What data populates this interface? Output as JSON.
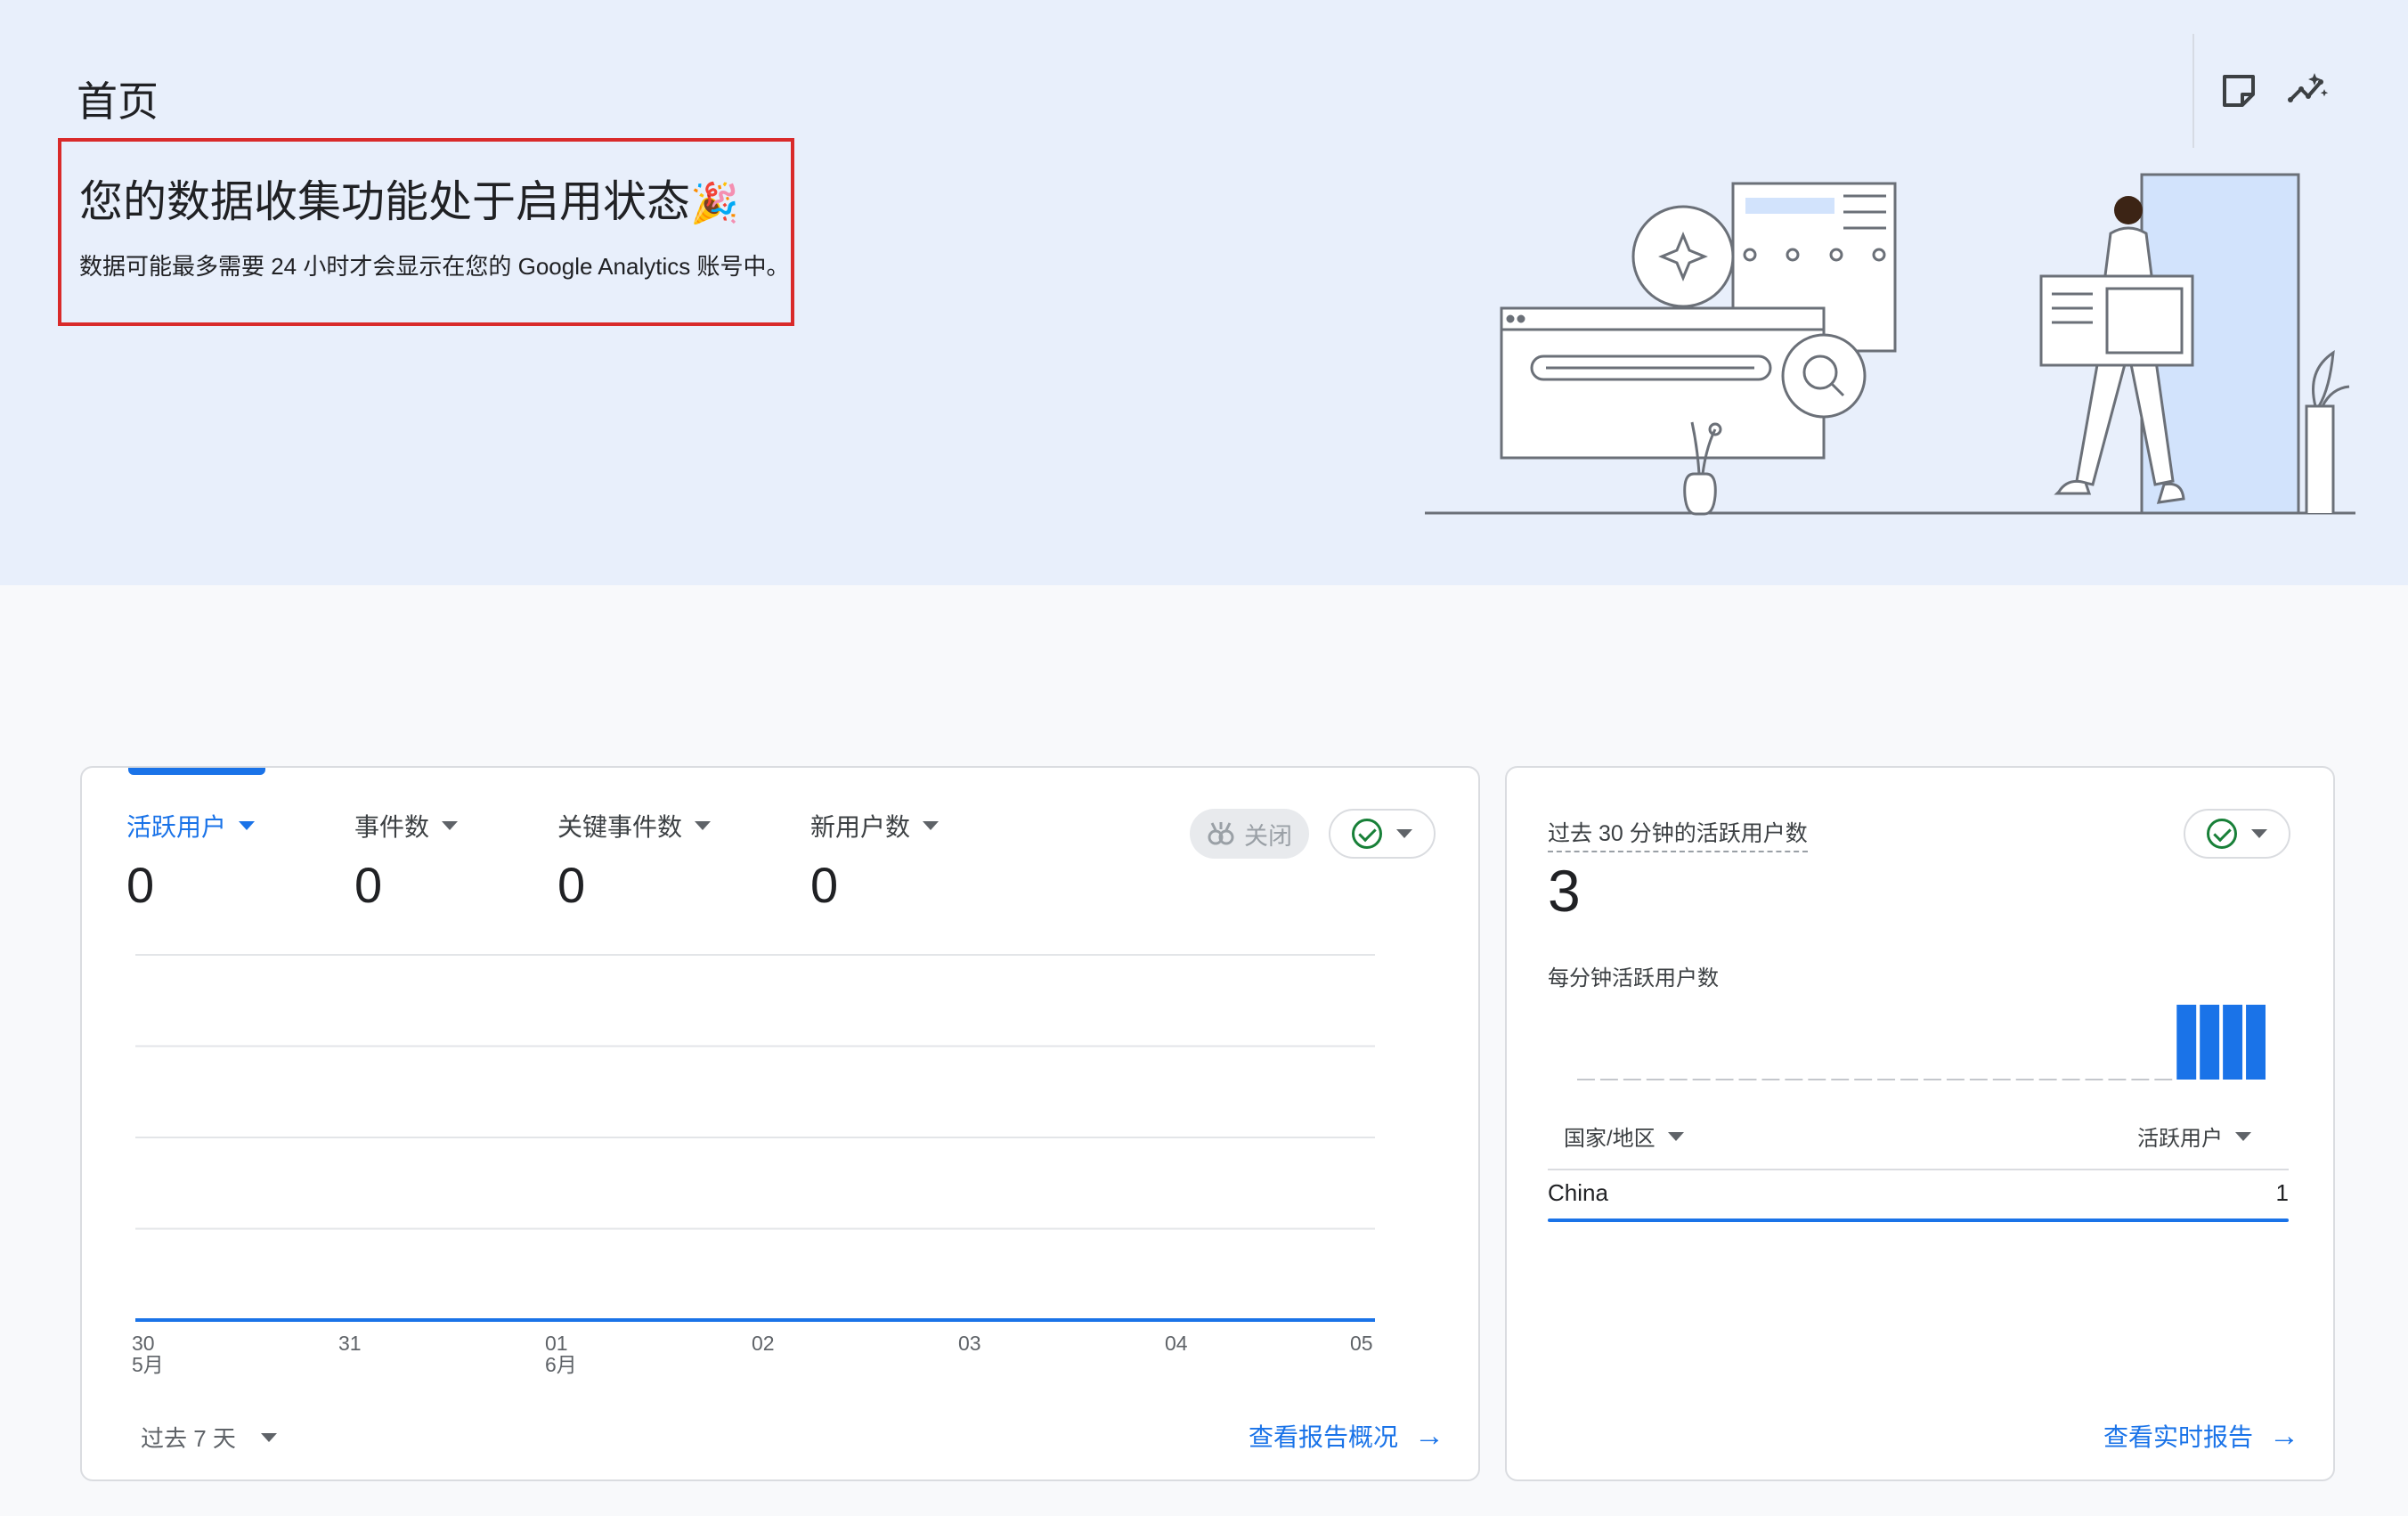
{
  "page": {
    "title": "首页",
    "banner": {
      "heading": "您的数据收集功能处于启用状态",
      "heading_emoji": "🎉",
      "subtext": "数据可能最多需要 24 小时才会显示在您的 Google Analytics 账号中。"
    },
    "toolbar_icons": [
      "note-icon",
      "insights-icon"
    ]
  },
  "overview_card": {
    "metrics": [
      {
        "label": "活跃用户",
        "value": "0",
        "active": true
      },
      {
        "label": "事件数",
        "value": "0",
        "active": false
      },
      {
        "label": "关键事件数",
        "value": "0",
        "active": false
      },
      {
        "label": "新用户数",
        "value": "0",
        "active": false
      }
    ],
    "compare_pill": {
      "label": "关闭"
    },
    "date_range": "过去 7 天",
    "link": "查看报告概况",
    "chart_data": {
      "type": "line",
      "x": [
        "30",
        "31",
        "01",
        "02",
        "03",
        "04",
        "05"
      ],
      "x_month_labels": {
        "0": "5月",
        "2": "6月"
      },
      "series": [
        {
          "values": [
            0,
            0,
            0,
            0,
            0,
            0,
            0
          ]
        }
      ],
      "grid": true,
      "colors": [
        "#1a73e8"
      ]
    }
  },
  "realtime_card": {
    "title": "过去 30 分钟的活跃用户数",
    "count": "3",
    "subtitle": "每分钟活跃用户数",
    "table": {
      "headers": [
        "国家/地区",
        "活跃用户"
      ],
      "rows": [
        {
          "country": "China",
          "value": "1"
        }
      ]
    },
    "link": "查看实时报告",
    "chart_data": {
      "type": "bar",
      "values": [
        0,
        0,
        0,
        0,
        0,
        0,
        0,
        0,
        0,
        0,
        0,
        0,
        0,
        0,
        0,
        0,
        0,
        0,
        0,
        0,
        0,
        0,
        0,
        0,
        0,
        0,
        1,
        1,
        1,
        1
      ],
      "colors": [
        "#1a73e8"
      ]
    }
  }
}
